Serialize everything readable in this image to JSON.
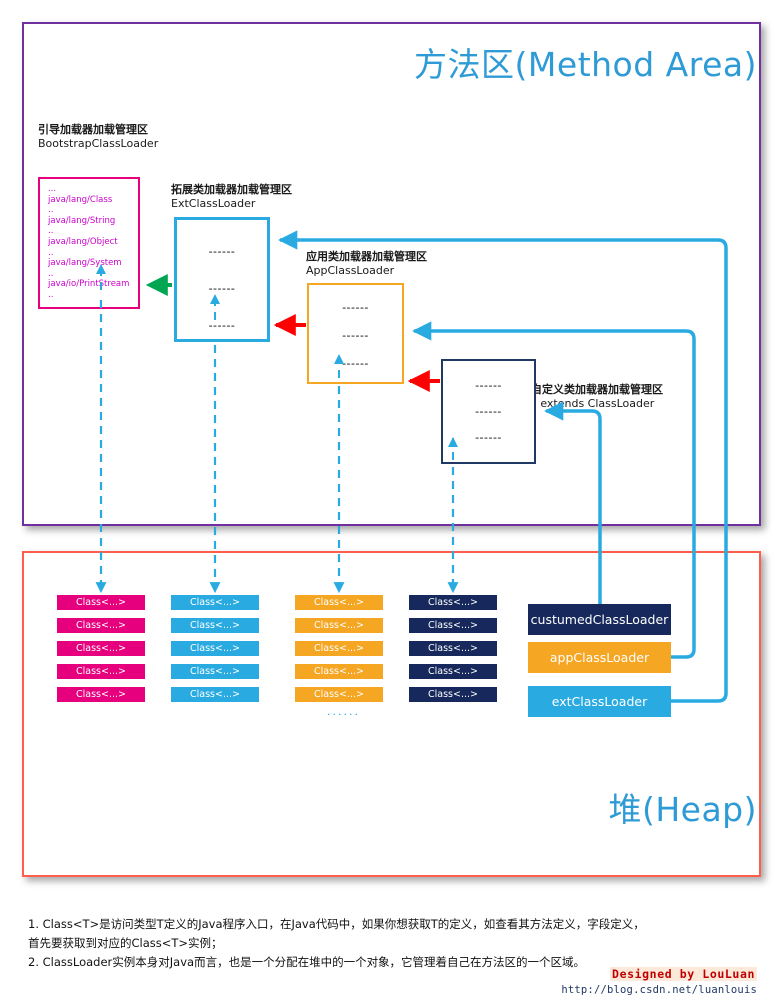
{
  "regions": {
    "method_area_title": "方法区(Method Area)",
    "heap_title": "堆(Heap)"
  },
  "loaders": [
    {
      "id": "bootstrap",
      "caption_cn": "引导加载器加载管理区",
      "caption_en": "BootstrapClassLoader",
      "color": "#e6007e",
      "entries": [
        "...",
        "java/lang/Class",
        "..",
        "java/lang/String",
        "..",
        "java/lang/Object",
        "..",
        "java/lang/System",
        "..",
        "java/io/PrintStream",
        ".."
      ]
    },
    {
      "id": "ext",
      "caption_cn": "拓展类加载器加载管理区",
      "caption_en": "ExtClassLoader",
      "color": "#29abe2",
      "placeholders": [
        "------",
        "------",
        "------"
      ]
    },
    {
      "id": "app",
      "caption_cn": "应用类加载器加载管理区",
      "caption_en": "AppClassLoader",
      "color": "#f5a623",
      "placeholders": [
        "------",
        "------",
        "------"
      ]
    },
    {
      "id": "custom",
      "caption_cn": "自定义类加载器加载管理区",
      "caption_en": "? extends ClassLoader",
      "color": "#17295c",
      "placeholders": [
        "------",
        "------",
        "------"
      ]
    }
  ],
  "heap": {
    "class_label": "Class<...>",
    "ellipsis": "······",
    "columns": [
      {
        "id": "bootstrap-classes",
        "color": "#e6007e",
        "count": 5
      },
      {
        "id": "ext-classes",
        "color": "#29abe2",
        "count": 5
      },
      {
        "id": "app-classes",
        "color": "#f5a623",
        "count": 5
      },
      {
        "id": "custom-classes",
        "color": "#17295c",
        "count": 5
      }
    ],
    "loader_objects": [
      {
        "id": "custumed",
        "label": "custumedClassLoader",
        "color": "#17295c"
      },
      {
        "id": "app",
        "label": "appClassLoader",
        "color": "#f5a623"
      },
      {
        "id": "ext",
        "label": "extClassLoader",
        "color": "#29abe2"
      }
    ]
  },
  "notes": {
    "line1": "1. Class<T>是访问类型T定义的Java程序入口，在Java代码中，如果你想获取T的定义，如查看其方法定义，字段定义，",
    "line2": "首先要获取到对应的Class<T>实例；",
    "line3": "2. ClassLoader实例本身对Java而言，也是一个分配在堆中的一个对象，它管理着自己在方法区的一个区域。"
  },
  "signature": {
    "name": "Designed by LouLuan",
    "url": "http://blog.csdn.net/luanlouis"
  }
}
